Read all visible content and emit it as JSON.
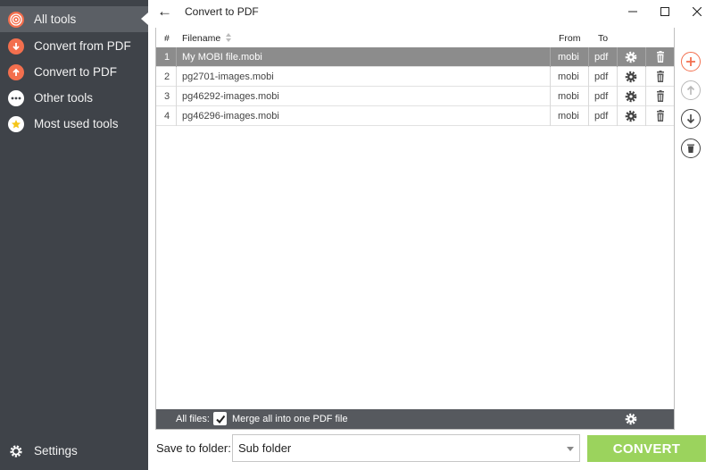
{
  "sidebar": {
    "items": [
      {
        "label": "All tools",
        "icon": "target-icon",
        "color": "#f36f4e"
      },
      {
        "label": "Convert from PDF",
        "icon": "arrow-down-icon",
        "color": "#f36f4e"
      },
      {
        "label": "Convert to PDF",
        "icon": "arrow-up-icon",
        "color": "#f36f4e"
      },
      {
        "label": "Other tools",
        "icon": "ellipsis-icon",
        "color": "#ffffff"
      },
      {
        "label": "Most used tools",
        "icon": "star-icon",
        "color": "#f5c518"
      }
    ],
    "settings_label": "Settings"
  },
  "titlebar": {
    "title": "Convert to PDF",
    "back_icon": "←"
  },
  "table": {
    "headers": {
      "num": "#",
      "filename": "Filename",
      "from": "From",
      "to": "To"
    },
    "rows": [
      {
        "num": "1",
        "filename": "My MOBI file.mobi",
        "from": "mobi",
        "to": "pdf"
      },
      {
        "num": "2",
        "filename": "pg2701-images.mobi",
        "from": "mobi",
        "to": "pdf"
      },
      {
        "num": "3",
        "filename": "pg46292-images.mobi",
        "from": "mobi",
        "to": "pdf"
      },
      {
        "num": "4",
        "filename": "pg46296-images.mobi",
        "from": "mobi",
        "to": "pdf"
      }
    ],
    "selected_row": 1
  },
  "footer": {
    "all_files_label": "All files:",
    "merge_label": "Merge all into one PDF file",
    "merge_checked": true
  },
  "save": {
    "label": "Save to folder:",
    "value": "Sub folder"
  },
  "convert_label": "CONVERT",
  "colors": {
    "accent": "#f36f4e",
    "convert_green": "#9bd35d",
    "sidebar_bg": "#3f4349"
  }
}
